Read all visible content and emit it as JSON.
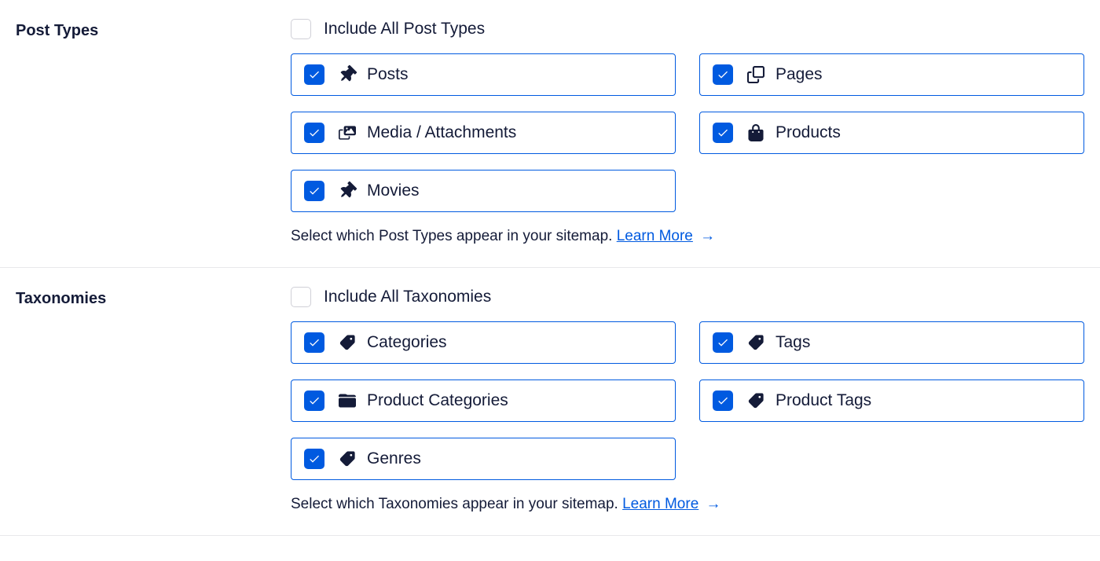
{
  "colors": {
    "accent": "#005ae0",
    "text": "#141b38"
  },
  "sections": {
    "postTypes": {
      "title": "Post Types",
      "includeAll": {
        "label": "Include All Post Types",
        "checked": false
      },
      "items": [
        {
          "label": "Posts",
          "icon": "pin",
          "checked": true
        },
        {
          "label": "Pages",
          "icon": "copy",
          "checked": true
        },
        {
          "label": "Media / Attachments",
          "icon": "media",
          "checked": true
        },
        {
          "label": "Products",
          "icon": "bag",
          "checked": true
        },
        {
          "label": "Movies",
          "icon": "pin",
          "checked": true
        }
      ],
      "helper": "Select which Post Types appear in your sitemap.",
      "learnMore": "Learn More"
    },
    "taxonomies": {
      "title": "Taxonomies",
      "includeAll": {
        "label": "Include All Taxonomies",
        "checked": false
      },
      "items": [
        {
          "label": "Categories",
          "icon": "tag",
          "checked": true
        },
        {
          "label": "Tags",
          "icon": "tag",
          "checked": true
        },
        {
          "label": "Product Categories",
          "icon": "folder",
          "checked": true
        },
        {
          "label": "Product Tags",
          "icon": "tag",
          "checked": true
        },
        {
          "label": "Genres",
          "icon": "tag",
          "checked": true
        }
      ],
      "helper": "Select which Taxonomies appear in your sitemap.",
      "learnMore": "Learn More"
    }
  }
}
